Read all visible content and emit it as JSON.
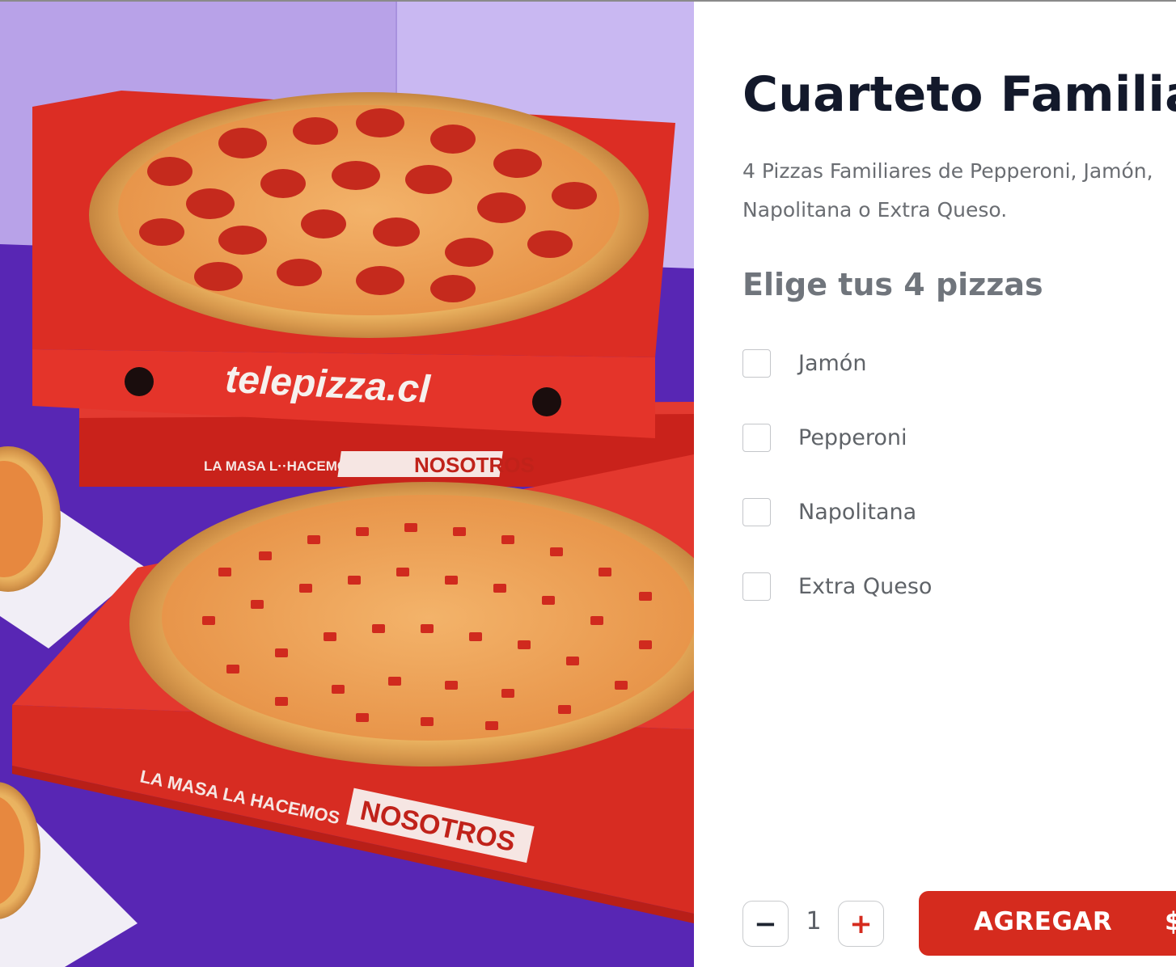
{
  "product": {
    "title": "Cuarteto Familiar",
    "description": "4 Pizzas Familiares de Pepperoni, Jamón, Napolitana o Extra Queso.",
    "choose_heading": "Elige tus 4 pizzas"
  },
  "options": [
    {
      "label": "Jamón",
      "checked": false
    },
    {
      "label": "Pepperoni",
      "checked": false
    },
    {
      "label": "Napolitana",
      "checked": false
    },
    {
      "label": "Extra Queso",
      "checked": false
    }
  ],
  "quantity": {
    "minus": "−",
    "value": "1",
    "plus": "+"
  },
  "add_button": {
    "label": "AGREGAR",
    "price_partial": "$"
  },
  "image_text": {
    "box_brand": "telepizza.cl",
    "slogan_prefix": "LA MASA LA HACEMOS",
    "slogan_badge": "NOSOTROS",
    "slogan_prefix_top": "LA MASA L··HACEMOS"
  },
  "colors": {
    "brand_red": "#d52b1e",
    "title_dark": "#13192b",
    "wall_lavender": "#c2b1ec",
    "floor_purple": "#5a24b0"
  }
}
